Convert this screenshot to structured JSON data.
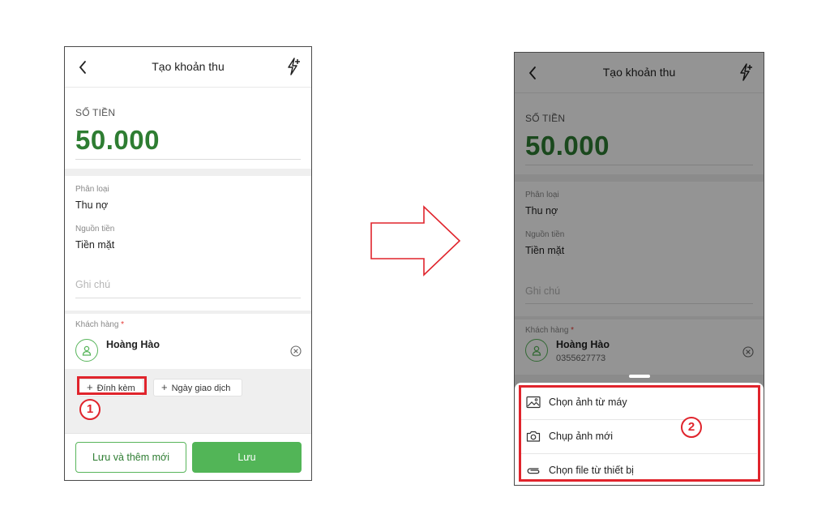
{
  "screen_left": {
    "header": {
      "title": "Tạo khoản thu"
    },
    "amount": {
      "label": "SỐ TIỀN",
      "value": "50.000"
    },
    "category": {
      "label": "Phân loại",
      "value": "Thu nợ"
    },
    "source": {
      "label": "Nguồn tiền",
      "value": "Tiền mặt"
    },
    "note": {
      "placeholder": "Ghi chú"
    },
    "customer": {
      "label": "Khách hàng",
      "required_mark": "*",
      "name": "Hoàng Hào"
    },
    "chips": {
      "attach": "Đính kèm",
      "date": "Ngày giao dịch"
    },
    "step_marker": "1",
    "footer": {
      "save_and_new": "Lưu và thêm mới",
      "save": "Lưu"
    }
  },
  "screen_right": {
    "header": {
      "title": "Tạo khoản thu"
    },
    "amount": {
      "label": "SỐ TIỀN",
      "value": "50.000"
    },
    "category": {
      "label": "Phân loại",
      "value": "Thu nợ"
    },
    "source": {
      "label": "Nguồn tiền",
      "value": "Tiền mặt"
    },
    "note": {
      "placeholder": "Ghi chú"
    },
    "customer": {
      "label": "Khách hàng",
      "required_mark": "*",
      "name": "Hoàng Hào",
      "phone": "0355627773"
    },
    "sheet": {
      "options": [
        {
          "label": "Chọn ảnh từ máy",
          "icon": "image-icon"
        },
        {
          "label": "Chụp ảnh mới",
          "icon": "camera-icon"
        },
        {
          "label": "Chọn file từ thiết bị",
          "icon": "paperclip-icon"
        }
      ]
    },
    "step_marker": "2"
  },
  "colors": {
    "accent_green": "#52b557",
    "amount_green": "#2e7d32",
    "highlight_red": "#e0242c"
  }
}
